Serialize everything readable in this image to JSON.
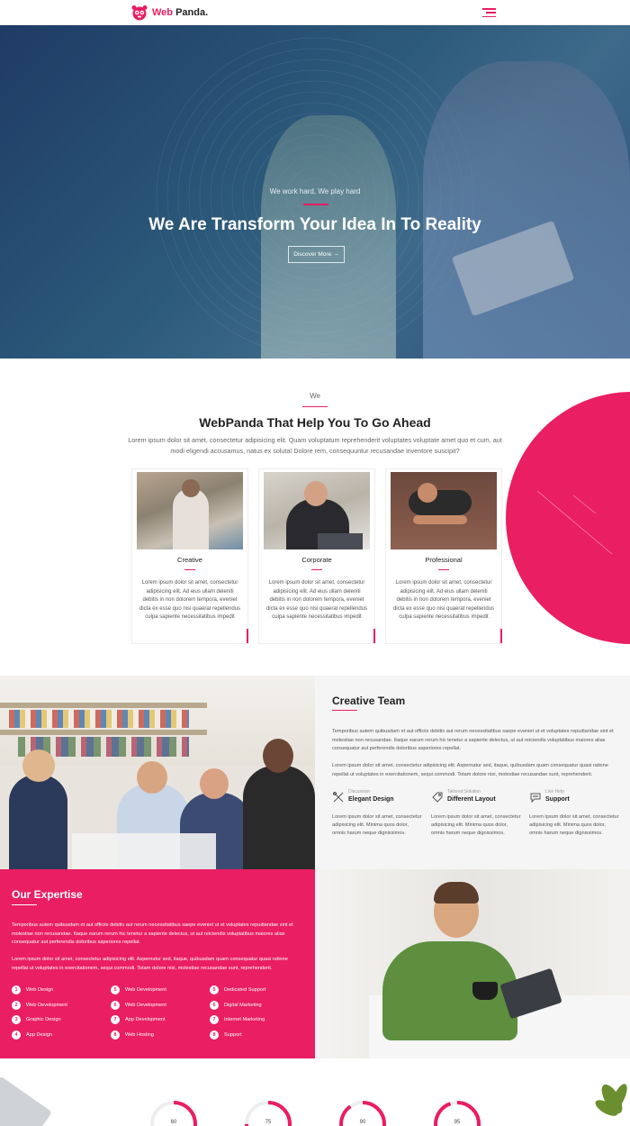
{
  "brand": {
    "name_part1": "Web",
    "name_part2": "Panda.",
    "accent": "#e91e63"
  },
  "nav": {
    "menu_icon": "hamburger-icon"
  },
  "hero": {
    "subtitle": "We work hard, We play hard",
    "title": "We Are Transform Your Idea In To Reality",
    "button_label": "Discover More"
  },
  "about": {
    "eyebrow": "We",
    "title": "WebPanda That Help You To Go Ahead",
    "description": "Lorem ipsum dolor sit amet, consectetur adipisicing elit. Quam voluptatum reprehenderit voluptates voluptate amet quo et cum, aut modi eligendi accusamus, natus ex soluta! Dolore rem, consequuntur recusandae inventore suscipit?",
    "cards": [
      {
        "title": "Creative",
        "text": "Lorem ipsum dolor sit amet, consectetur adipisicing elit. Ad eius ullam deleniti debitis in non dolorem tempora, eveniet dicta ex esse quo nisi quaerat repellendus culpa sapiente necessitatibus impedit"
      },
      {
        "title": "Corporate",
        "text": "Lorem ipsum dolor sit amet, consectetur adipisicing elit. Ad eius ullam deleniti debitis in non dolorem tempora, eveniet dicta ex esse quo nisi quaerat repellendus culpa sapiente necessitatibus impedit"
      },
      {
        "title": "Professional",
        "text": "Lorem ipsum dolor sit amet, consectetur adipisicing elit. Ad eius ullam deleniti debitis in non dolorem tempora, eveniet dicta ex esse quo nisi quaerat repellendus culpa sapiente necessitatibus impedit"
      }
    ]
  },
  "team": {
    "title": "Creative Team",
    "paragraph1": "Temporibus autem quibusdam et aut officiis debitis aut rerum necessitatibus saepe eveniet ut et voluptates repudiandae sint et molestiae non recusandae. Itaque earum rerum hic tenetur a sapiente delectus, ut aut reiciendis voluptatibus maiores alias consequatur aut perferendis doloribus asperiores repellat.",
    "paragraph2": "Lorem ipsum dolor sit amet, consectetur adipisicing elit. Aspernatur sed, itaque, quibusdam quam consequatur quasi ratione repellat ut voluptates in exercitationem, sequi commodi. Totam dolore nisi, molestiae recusandae sunt, reprehenderit.",
    "features": [
      {
        "small": "Discussion",
        "name": "Elegant Design",
        "icon": "tools-icon",
        "text": "Lorem ipsum dolor sit amet, consectetur adipisicing elit. Minima quos dolor, omnis harum neque dignissimos."
      },
      {
        "small": "Tailored Solution",
        "name": "Different Layout",
        "icon": "tag-icon",
        "text": "Lorem ipsum dolor sit amet, consectetur adipisicing elit. Minima quos dolor, omnis harum neque dignissimos."
      },
      {
        "small": "Live Help",
        "name": "Support",
        "icon": "chat-icon",
        "text": "Lorem ipsum dolor sit amet, consectetur adipisicing elit. Minima quos dolor, omnis harum neque dignissimos."
      }
    ]
  },
  "expertise": {
    "title": "Our Expertise",
    "paragraph1": "Temporibus autem quibusdam et aut officiis debitis aut rerum necessitatibus saepe eveniet ut et voluptates repudiandae sint et molestiae non recusandae. Itaque earum rerum hic tenetur a sapiente delectus, ut aut reiciendis voluptatibus maiores alias consequatur aut perferendis doloribus asperiores repellat.",
    "paragraph2": "Lorem ipsum dolor sit amet, consectetur adipisicing elit. Aspernatur sed, itaque, quibusdam quam consequatur quasi ratione repellat ut voluptates in exercitationem, sequi commodi. Totam dolore nisi, molestiae recusandae sunt, reprehenderit.",
    "items": [
      {
        "num": "1",
        "label": "Web Design"
      },
      {
        "num": "2",
        "label": "Web Development"
      },
      {
        "num": "3",
        "label": "Graphic Design"
      },
      {
        "num": "4",
        "label": "App Design"
      },
      {
        "num": "5",
        "label": "Web Development"
      },
      {
        "num": "6",
        "label": "Web Development"
      },
      {
        "num": "7",
        "label": "App Development"
      },
      {
        "num": "8",
        "label": "Web Hosting"
      },
      {
        "num": "5",
        "label": "Dedicated Support"
      },
      {
        "num": "6",
        "label": "Digital Marketing"
      },
      {
        "num": "7",
        "label": "Internet Marketing"
      },
      {
        "num": "8",
        "label": "Support"
      }
    ]
  },
  "stats": {
    "values": [
      "60",
      "75",
      "90",
      "95"
    ]
  }
}
